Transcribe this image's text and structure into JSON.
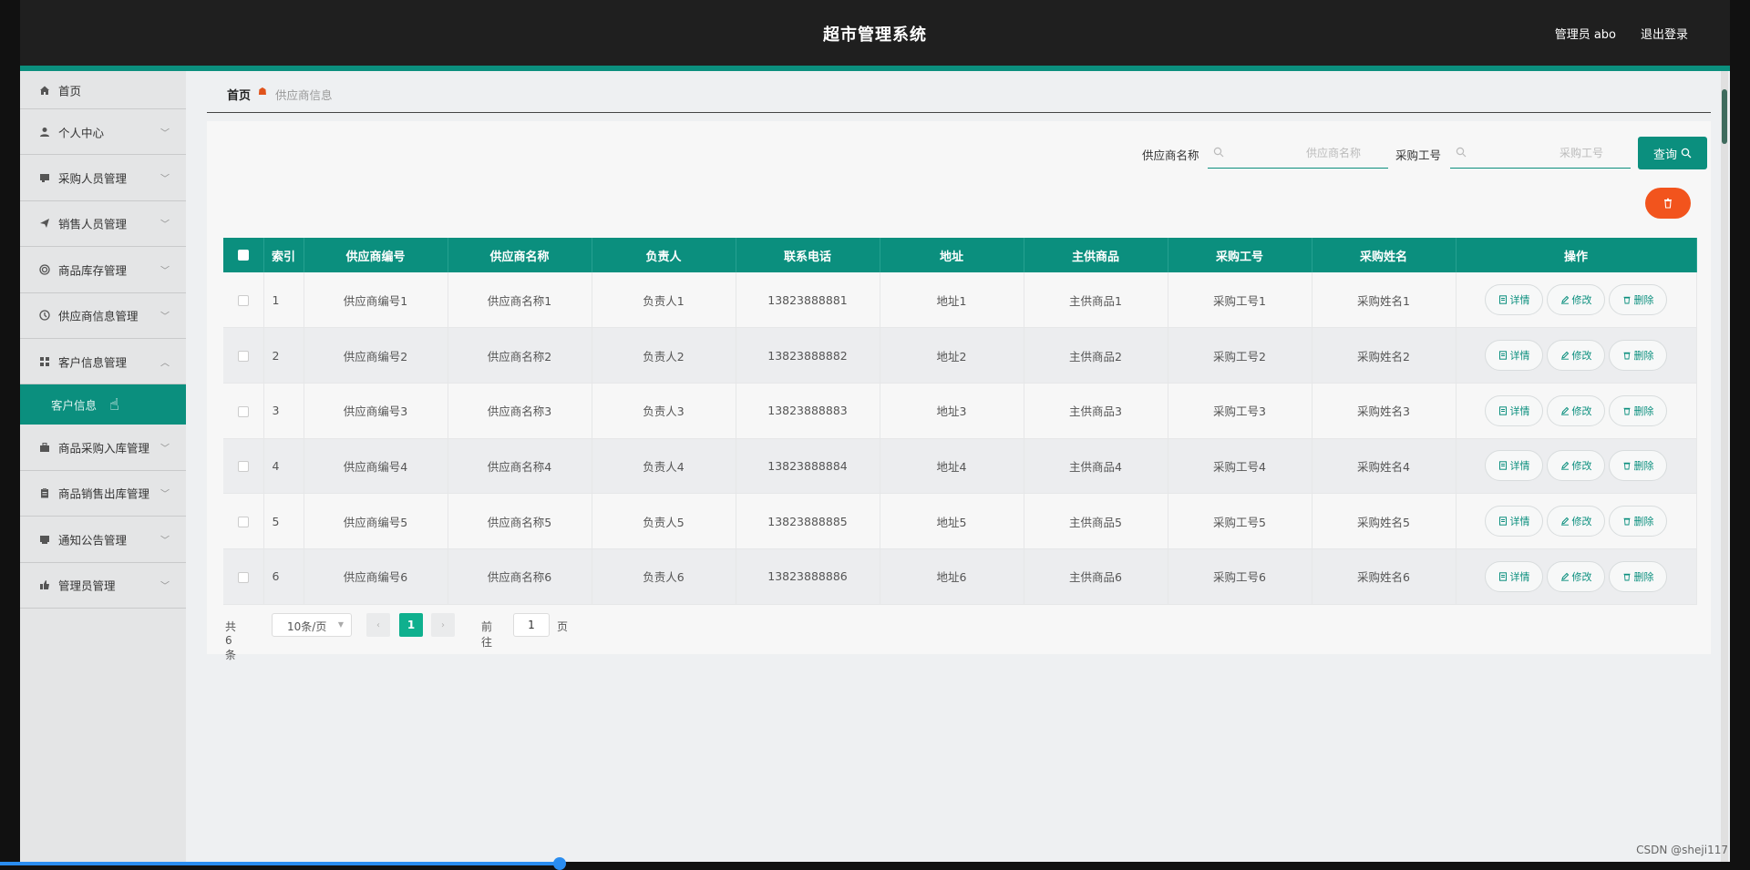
{
  "header": {
    "title": "超市管理系统",
    "user": "管理员 abo",
    "logout": "退出登录"
  },
  "sidebar": {
    "home": "首页",
    "items": [
      {
        "label": "个人中心",
        "icon": "user-icon"
      },
      {
        "label": "采购人员管理",
        "icon": "card-icon"
      },
      {
        "label": "销售人员管理",
        "icon": "send-icon"
      },
      {
        "label": "商品库存管理",
        "icon": "circle-icon"
      },
      {
        "label": "供应商信息管理",
        "icon": "clock-icon"
      },
      {
        "label": "客户信息管理",
        "icon": "grid-icon"
      }
    ],
    "active_sub": "客户信息",
    "items_after": [
      {
        "label": "商品采购入库管理",
        "icon": "box-icon"
      },
      {
        "label": "商品销售出库管理",
        "icon": "clipboard-icon"
      },
      {
        "label": "通知公告管理",
        "icon": "notice-icon"
      },
      {
        "label": "管理员管理",
        "icon": "thumb-icon"
      }
    ]
  },
  "breadcrumb": {
    "home": "首页",
    "current": "供应商信息"
  },
  "search": {
    "name_label": "供应商名称",
    "name_placeholder": "供应商名称",
    "code_label": "采购工号",
    "code_placeholder": "采购工号",
    "query_label": "查询"
  },
  "table": {
    "headers": [
      "索引",
      "供应商编号",
      "供应商名称",
      "负责人",
      "联系电话",
      "地址",
      "主供商品",
      "采购工号",
      "采购姓名",
      "操作"
    ],
    "rows": [
      [
        "1",
        "供应商编号1",
        "供应商名称1",
        "负责人1",
        "13823888881",
        "地址1",
        "主供商品1",
        "采购工号1",
        "采购姓名1"
      ],
      [
        "2",
        "供应商编号2",
        "供应商名称2",
        "负责人2",
        "13823888882",
        "地址2",
        "主供商品2",
        "采购工号2",
        "采购姓名2"
      ],
      [
        "3",
        "供应商编号3",
        "供应商名称3",
        "负责人3",
        "13823888883",
        "地址3",
        "主供商品3",
        "采购工号3",
        "采购姓名3"
      ],
      [
        "4",
        "供应商编号4",
        "供应商名称4",
        "负责人4",
        "13823888884",
        "地址4",
        "主供商品4",
        "采购工号4",
        "采购姓名4"
      ],
      [
        "5",
        "供应商编号5",
        "供应商名称5",
        "负责人5",
        "13823888885",
        "地址5",
        "主供商品5",
        "采购工号5",
        "采购姓名5"
      ],
      [
        "6",
        "供应商编号6",
        "供应商名称6",
        "负责人6",
        "13823888886",
        "地址6",
        "主供商品6",
        "采购工号6",
        "采购姓名6"
      ]
    ],
    "actions": {
      "detail": "详情",
      "edit": "修改",
      "delete": "删除"
    }
  },
  "pagination": {
    "total": "共 6 条",
    "page_size": "10条/页",
    "current": "1",
    "goto": "前往",
    "goto_value": "1",
    "page_unit": "页"
  },
  "watermark": "CSDN @sheji117",
  "colors": {
    "accent": "#0b8f7e",
    "danger": "#f2541d",
    "header_bg": "#1f1f1f"
  }
}
